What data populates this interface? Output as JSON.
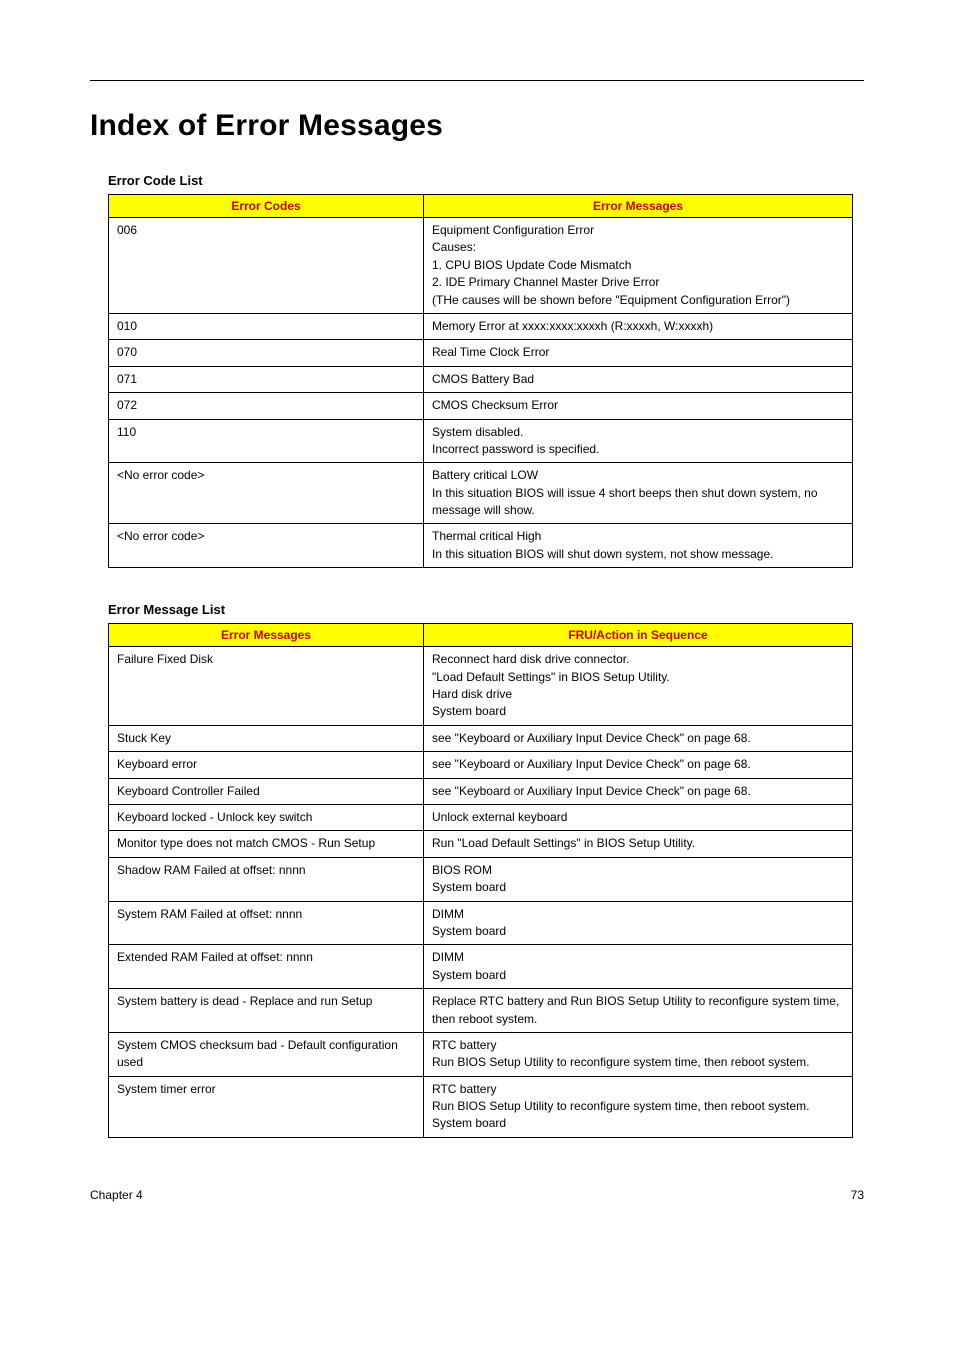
{
  "heading": "Index of Error Messages",
  "section1_title": "Error Code List",
  "section2_title": "Error Message List",
  "table1": {
    "headers": [
      "Error Codes",
      "Error Messages"
    ],
    "rows": [
      {
        "c0": "006",
        "c1": "Equipment Configuration Error\nCauses:\n1. CPU BIOS Update Code Mismatch\n2. IDE Primary Channel Master Drive Error\n(THe causes will be shown before \"Equipment Configuration Error\")"
      },
      {
        "c0": "010",
        "c1": "Memory Error at xxxx:xxxx:xxxxh (R:xxxxh, W:xxxxh)"
      },
      {
        "c0": "070",
        "c1": "Real Time Clock Error"
      },
      {
        "c0": "071",
        "c1": "CMOS Battery Bad"
      },
      {
        "c0": "072",
        "c1": "CMOS Checksum Error"
      },
      {
        "c0": "110",
        "c1": "System disabled.\nIncorrect password is specified."
      },
      {
        "c0": "<No error code>",
        "c1": "Battery critical LOW\nIn this situation BIOS will issue 4 short beeps then shut down system, no message will show."
      },
      {
        "c0": "<No error code>",
        "c1": "Thermal critical High\nIn this situation BIOS will shut down system, not show message."
      }
    ]
  },
  "table2": {
    "headers": [
      "Error Messages",
      "FRU/Action in Sequence"
    ],
    "rows": [
      {
        "c0": "Failure Fixed Disk",
        "c1": "Reconnect hard disk drive connector.\n\"Load Default Settings\" in BIOS Setup Utility.\nHard disk drive\nSystem board"
      },
      {
        "c0": "Stuck Key",
        "c1": "see \"Keyboard or Auxiliary Input Device Check\" on page 68."
      },
      {
        "c0": "Keyboard error",
        "c1": "see \"Keyboard or Auxiliary Input Device Check\" on page 68."
      },
      {
        "c0": "Keyboard Controller Failed",
        "c1": "see \"Keyboard or Auxiliary Input Device Check\" on page 68."
      },
      {
        "c0": "Keyboard locked - Unlock key switch",
        "c1": "Unlock external keyboard"
      },
      {
        "c0": "Monitor type does not match CMOS - Run Setup",
        "c1": "Run \"Load Default Settings\" in BIOS Setup Utility."
      },
      {
        "c0": "Shadow RAM Failed at offset: nnnn",
        "c1": "BIOS ROM\nSystem board"
      },
      {
        "c0": "System RAM Failed at offset: nnnn",
        "c1": "DIMM\nSystem board"
      },
      {
        "c0": "Extended RAM Failed at offset: nnnn",
        "c1": "DIMM\nSystem board"
      },
      {
        "c0": "System battery is dead - Replace and run Setup",
        "c1": "Replace RTC battery and Run BIOS Setup Utility to reconfigure system time, then reboot system."
      },
      {
        "c0": "System CMOS checksum bad - Default configuration used",
        "c1": "RTC battery\nRun BIOS Setup Utility to reconfigure system time, then reboot system."
      },
      {
        "c0": "System timer error",
        "c1": "RTC battery\nRun BIOS Setup Utility to reconfigure system time, then reboot system.\nSystem board"
      }
    ]
  },
  "footer": {
    "left": "Chapter 4",
    "right": "73"
  }
}
